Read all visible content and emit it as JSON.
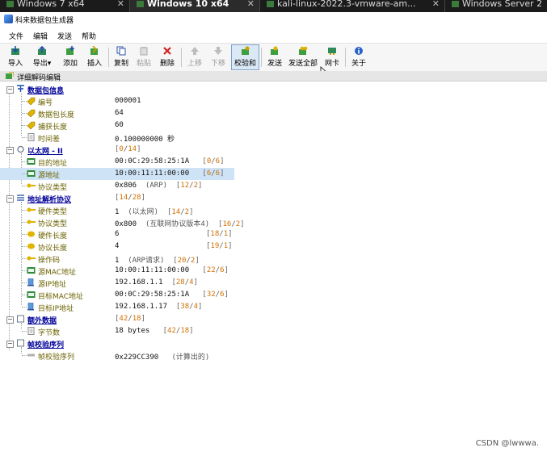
{
  "vm_tabs": [
    {
      "label": "Windows 7 x64",
      "active": false
    },
    {
      "label": "Windows 10 x64",
      "active": true
    },
    {
      "label": "kali-linux-2022.3-vmware-am...",
      "active": false
    },
    {
      "label": "Windows Server 2",
      "active": false
    }
  ],
  "window": {
    "title": "科来数据包生成器"
  },
  "menu": [
    "文件",
    "编辑",
    "发送",
    "帮助"
  ],
  "toolbar": {
    "import": "导入",
    "export": "导出",
    "add": "添加",
    "insert": "插入",
    "copy": "复制",
    "paste": "粘贴",
    "delete": "删除",
    "up": "上移",
    "down": "下移",
    "checksum": "校验和",
    "send": "发送",
    "send_all": "发送全部",
    "nic": "网卡",
    "about": "关于"
  },
  "panel": {
    "title": "详细解码编辑"
  },
  "tree": {
    "packet_info": {
      "label": "数据包信息",
      "fields": [
        {
          "label": "编号",
          "value": "000001"
        },
        {
          "label": "数据包长度",
          "value": "64"
        },
        {
          "label": "捕获长度",
          "value": "60"
        },
        {
          "label": "时间差",
          "value": "0.100000000 秒"
        }
      ]
    },
    "ethernet": {
      "label": "以太网 - II",
      "range": {
        "start": "0",
        "len": "14"
      },
      "fields": [
        {
          "label": "目的地址",
          "value": "00:0C:29:58:25:1A",
          "start": "0",
          "len": "6"
        },
        {
          "label": "源地址",
          "value": "10:00:11:11:00:00",
          "start": "6",
          "len": "6"
        },
        {
          "label": "协议类型",
          "value": "0x806",
          "note": "(ARP)",
          "start": "12",
          "len": "2"
        }
      ]
    },
    "arp": {
      "label": "地址解析协议",
      "range": {
        "start": "14",
        "len": "28"
      },
      "fields": [
        {
          "label": "硬件类型",
          "value": "1",
          "note": "(以太网)",
          "start": "14",
          "len": "2"
        },
        {
          "label": "协议类型",
          "value": "0x800",
          "note": "(互联网协议版本4)",
          "start": "16",
          "len": "2"
        },
        {
          "label": "硬件长度",
          "value": "6",
          "note": "",
          "start": "18",
          "len": "1"
        },
        {
          "label": "协议长度",
          "value": "4",
          "note": "",
          "start": "19",
          "len": "1"
        },
        {
          "label": "操作码",
          "value": "1",
          "note": "(ARP请求)",
          "start": "20",
          "len": "2"
        },
        {
          "label": "源MAC地址",
          "value": "10:00:11:11:00:00",
          "note": "",
          "start": "22",
          "len": "6"
        },
        {
          "label": "源IP地址",
          "value": "192.168.1.1",
          "note": "",
          "start": "28",
          "len": "4"
        },
        {
          "label": "目标MAC地址",
          "value": "00:0C:29:58:25:1A",
          "note": "",
          "start": "32",
          "len": "6"
        },
        {
          "label": "目标IP地址",
          "value": "192.168.1.17",
          "note": "",
          "start": "38",
          "len": "4"
        }
      ]
    },
    "extra": {
      "label": "额外数据",
      "range": {
        "start": "42",
        "len": "18"
      },
      "fields": [
        {
          "label": "字节数",
          "value": "18 bytes",
          "start": "42",
          "len": "18"
        }
      ]
    },
    "fcs": {
      "label": "帧校验序列",
      "fields": [
        {
          "label": "帧校验序列",
          "value": "0x229CC390",
          "note": "(计算出的)"
        }
      ]
    }
  },
  "watermark": "CSDN @lwwwa."
}
